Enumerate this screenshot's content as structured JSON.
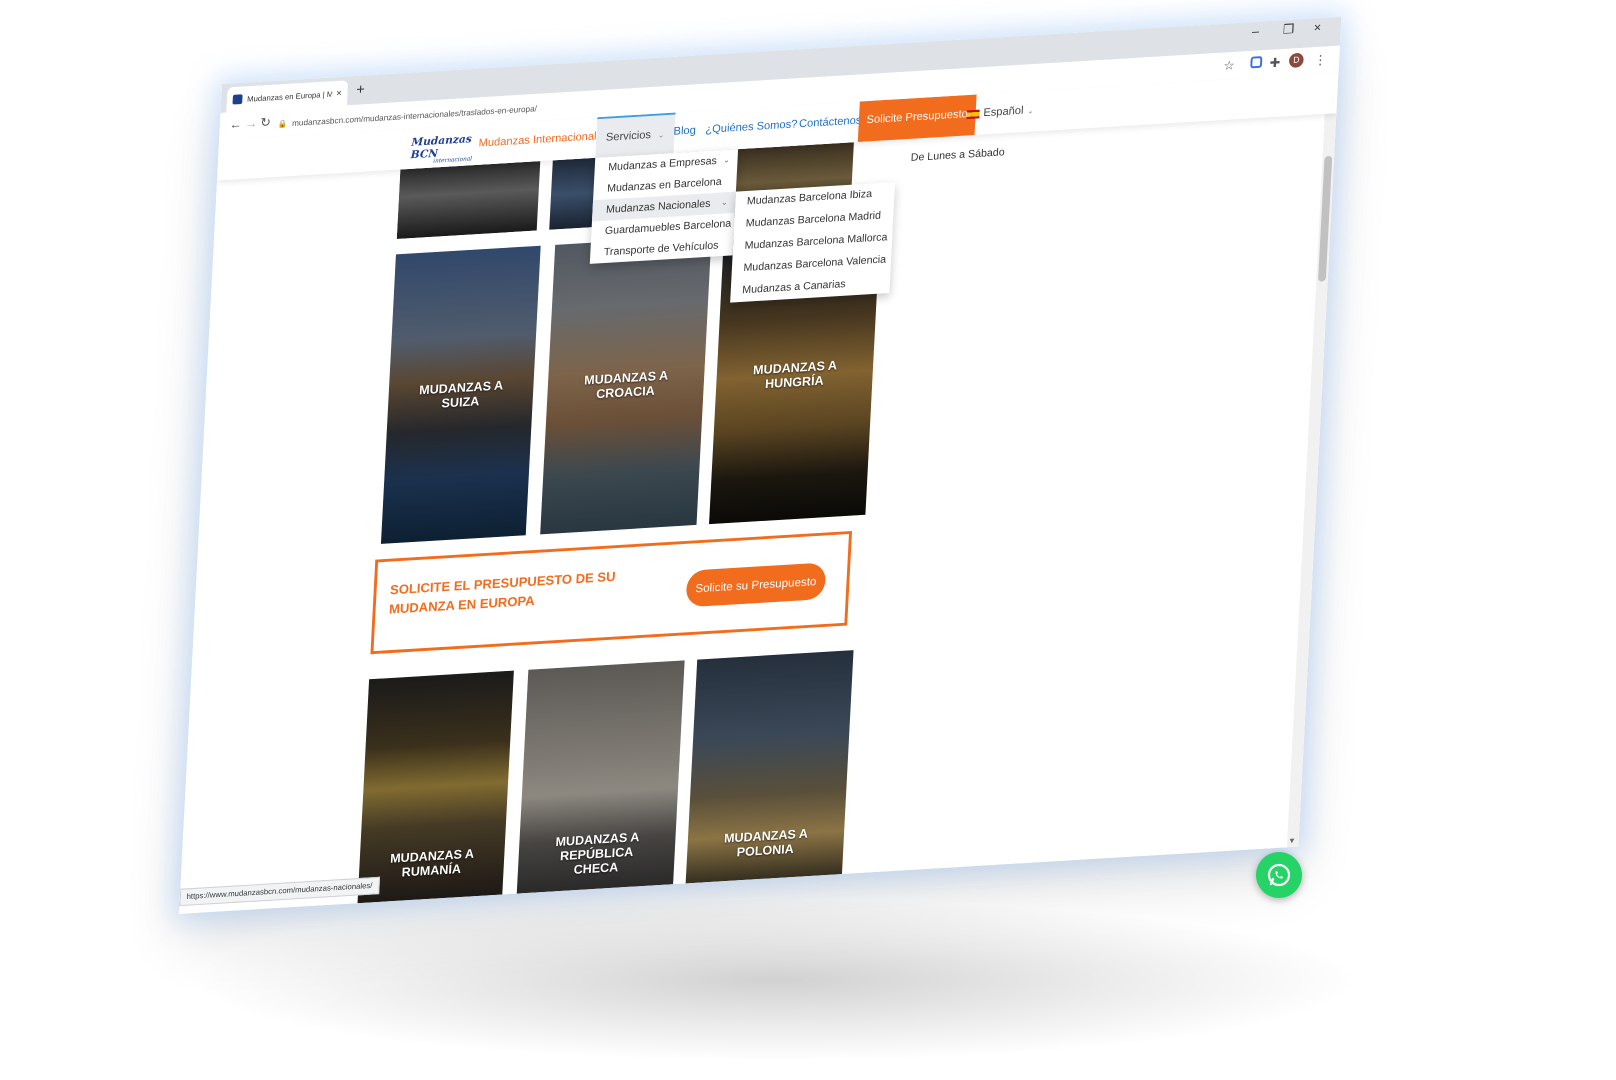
{
  "browser": {
    "tab_title": "Mudanzas en Europa | Mudanza",
    "tab_close": "×",
    "new_tab": "+",
    "url": "mudanzasbcn.com/mudanzas-internacionales/traslados-en-europa/",
    "window_controls": [
      "–",
      "❐",
      "×"
    ],
    "avatar_letter": "D",
    "status_url": "https://www.mudanzasbcn.com/mudanzas-nacionales/"
  },
  "site": {
    "logo_main": "Mudanzas BCN",
    "logo_sub": "internacional",
    "nav": {
      "internacionales": "Mudanzas Internacionales",
      "servicios": "Servicios",
      "blog": "Blog",
      "quienes": "¿Quiénes Somos?",
      "contacto": "Contáctenos",
      "cta": "Solicite Presupuesto",
      "idioma": "Español"
    },
    "hours": "De Lunes a Sábado",
    "servicios_menu": [
      "Mudanzas a Empresas",
      "Mudanzas en Barcelona",
      "Mudanzas Nacionales",
      "Guardamuebles Barcelona",
      "Transporte de Vehículos"
    ],
    "nacionales_submenu": [
      "Mudanzas Barcelona Ibiza",
      "Mudanzas Barcelona Madrid",
      "Mudanzas Barcelona Mallorca",
      "Mudanzas Barcelona Valencia",
      "Mudanzas a Canarias"
    ],
    "cards_row2": [
      "MUDANZAS A SUIZA",
      "MUDANZAS A CROACIA",
      "MUDANZAS A HUNGRÍA"
    ],
    "cards_row3": [
      "MUDANZAS A RUMANÍA",
      "MUDANZAS A REPÚBLICA CHECA",
      "MUDANZAS A POLONIA"
    ],
    "cta_box": {
      "text": "SOLICITE EL PRESUPUESTO DE SU MUDANZA EN EUROPA",
      "button": "Solicite su Presupuesto"
    }
  },
  "colors": {
    "accent": "#f26c1d",
    "link": "#1f6fc5",
    "brand": "#1d3f8c",
    "whatsapp": "#25d366"
  }
}
